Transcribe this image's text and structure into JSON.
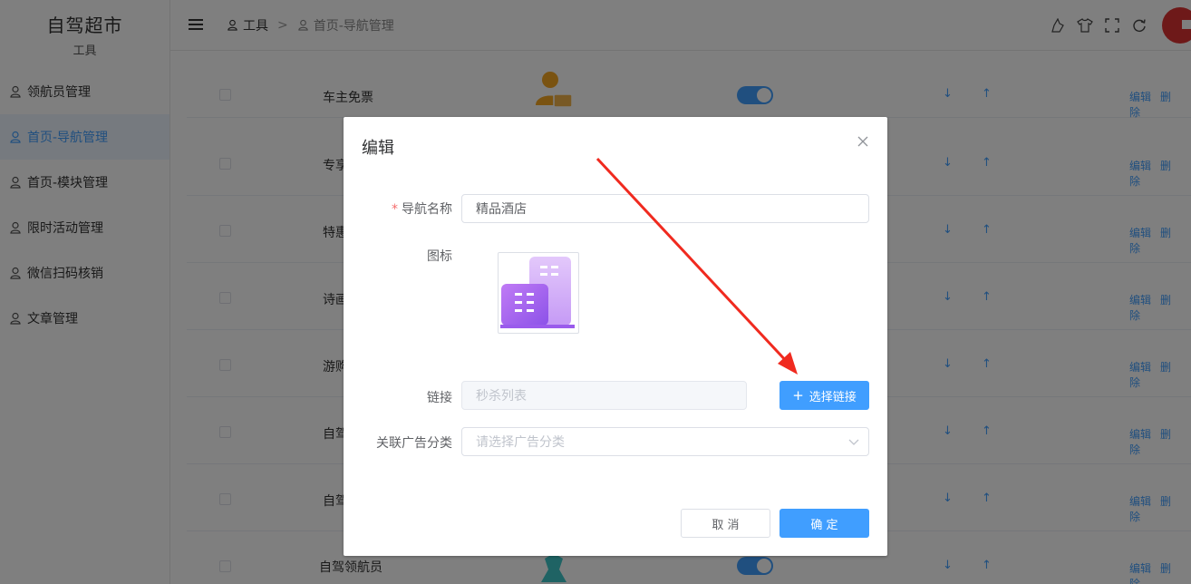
{
  "brand": {
    "title": "自驾超市",
    "subtitle": "工具"
  },
  "sidebar": {
    "items": [
      {
        "label": "领航员管理",
        "active": false
      },
      {
        "label": "首页-导航管理",
        "active": true
      },
      {
        "label": "首页-模块管理",
        "active": false
      },
      {
        "label": "限时活动管理",
        "active": false
      },
      {
        "label": "微信扫码核销",
        "active": false
      },
      {
        "label": "文章管理",
        "active": false
      }
    ]
  },
  "header": {
    "breadcrumb": [
      "工具",
      "首页-导航管理"
    ],
    "separator": ">"
  },
  "table": {
    "rows": [
      {
        "name": "车主免票"
      },
      {
        "name": "专享"
      },
      {
        "name": "特惠"
      },
      {
        "name": "诗画"
      },
      {
        "name": "游购"
      },
      {
        "name": "自驾"
      },
      {
        "name": "自驾"
      },
      {
        "name": "自驾领航员"
      }
    ],
    "sort_glyphs": "↓ ↑",
    "edit_label": "编辑",
    "delete_label": "删除"
  },
  "dialog": {
    "title": "编辑",
    "fields": {
      "nav_name": {
        "label": "导航名称",
        "required_mark": "*",
        "value": "精品酒店"
      },
      "icon": {
        "label": "图标"
      },
      "link": {
        "label": "链接",
        "placeholder": "秒杀列表"
      },
      "ad_category": {
        "label": "关联广告分类",
        "placeholder": "请选择广告分类"
      }
    },
    "choose_link_label": "选择链接",
    "cancel_label": "取 消",
    "confirm_label": "确 定"
  },
  "colors": {
    "primary": "#409eff",
    "arrow": "#f02a1f",
    "overlay": "rgba(0,0,0,0.5)",
    "required": "#f56c6c",
    "icon_purple": "#b57bf2"
  }
}
